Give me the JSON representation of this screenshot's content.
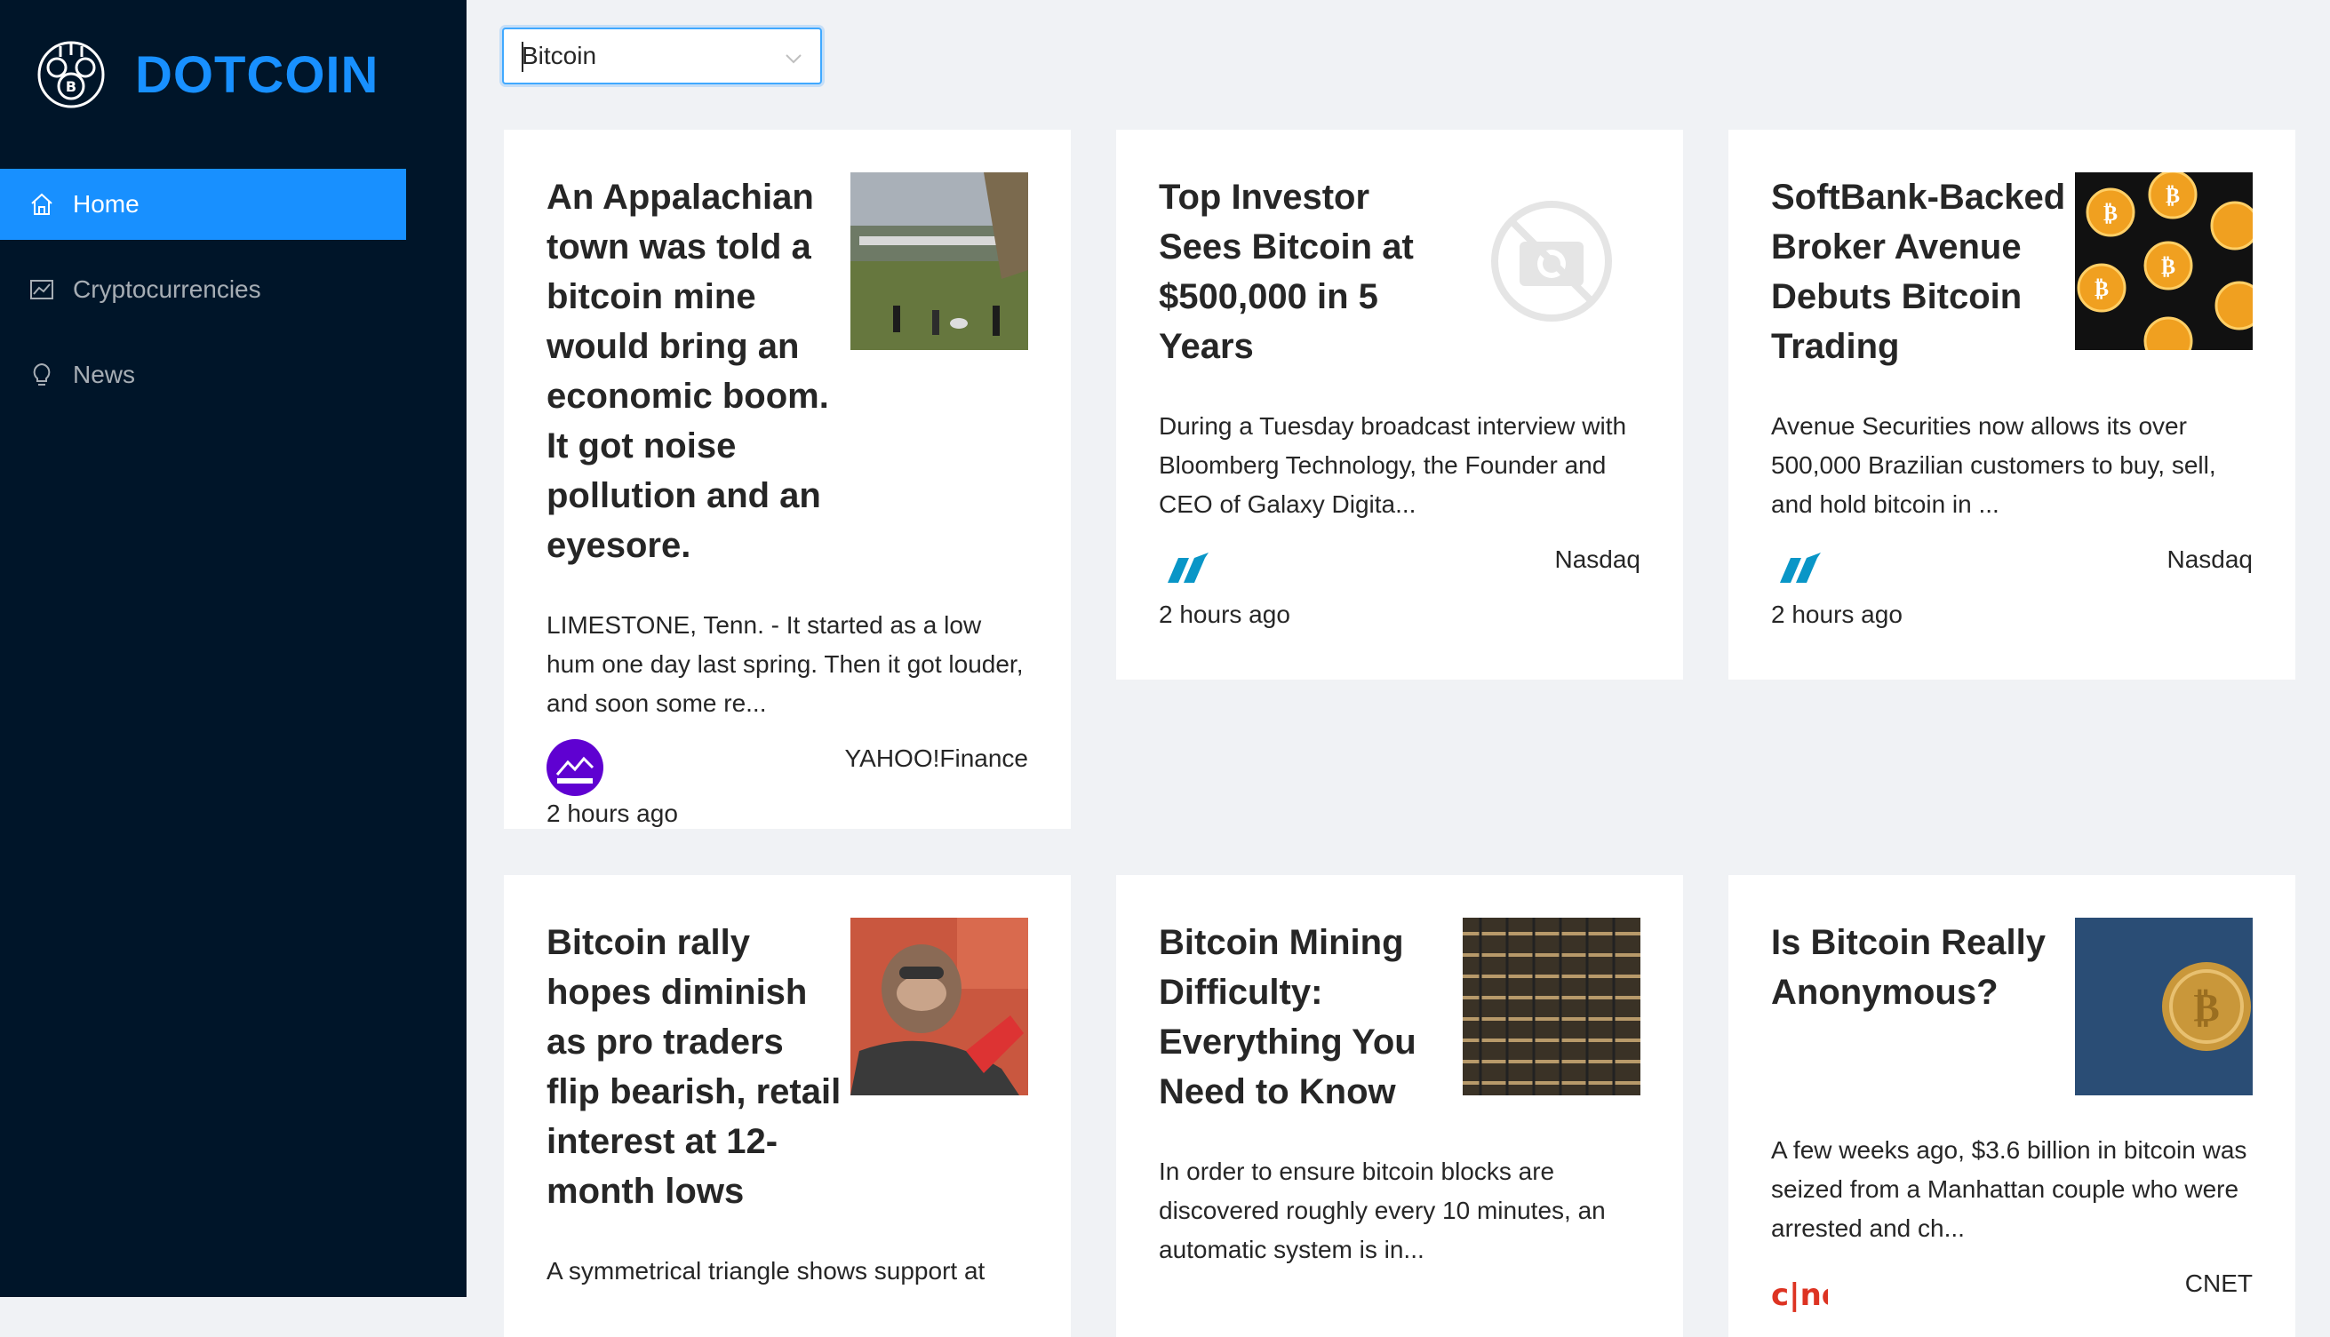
{
  "app": {
    "brand": "DOTCOIN"
  },
  "sidebar": {
    "items": [
      {
        "label": "Home",
        "icon": "home-icon",
        "active": true
      },
      {
        "label": "Cryptocurrencies",
        "icon": "chart-icon",
        "active": false
      },
      {
        "label": "News",
        "icon": "bulb-icon",
        "active": false
      }
    ]
  },
  "filter": {
    "selected": "Bitcoin"
  },
  "colors": {
    "sidebar_bg": "#001529",
    "accent": "#1890ff",
    "page_bg": "#f0f2f5"
  },
  "articles": [
    {
      "title": "An Appalachian town was told a bitcoin mine would bring an economic boom. It got noise pollution and an eyesore.",
      "description": "LIMESTONE, Tenn. - It started as a low hum one day last spring. Then it got louder, and soon some re...",
      "provider": "YAHOO!Finance",
      "time": "2 hours ago"
    },
    {
      "title": "Top Investor Sees Bitcoin at $500,000 in 5 Years",
      "description": "During a Tuesday broadcast interview with Bloomberg Technology, the Founder and CEO of Galaxy Digita...",
      "provider": "Nasdaq",
      "time": "2 hours ago"
    },
    {
      "title": "SoftBank-Backed Broker Avenue Debuts Bitcoin Trading",
      "description": "Avenue Securities now allows its over 500,000 Brazilian customers to buy, sell, and hold bitcoin in ...",
      "provider": "Nasdaq",
      "time": "2 hours ago"
    },
    {
      "title": "Bitcoin rally hopes diminish as pro traders flip bearish, retail interest at 12-month lows",
      "description": "A symmetrical triangle shows support at",
      "provider": "",
      "time": ""
    },
    {
      "title": "Bitcoin Mining Difficulty: Everything You Need to Know",
      "description": "In order to ensure bitcoin blocks are discovered roughly every 10 minutes, an automatic system is in...",
      "provider": "",
      "time": ""
    },
    {
      "title": "Is Bitcoin Really Anonymous?",
      "description": "A few weeks ago, $3.6 billion in bitcoin was seized from a Manhattan couple who were arrested and ch...",
      "provider": "CNET",
      "time": ""
    }
  ]
}
